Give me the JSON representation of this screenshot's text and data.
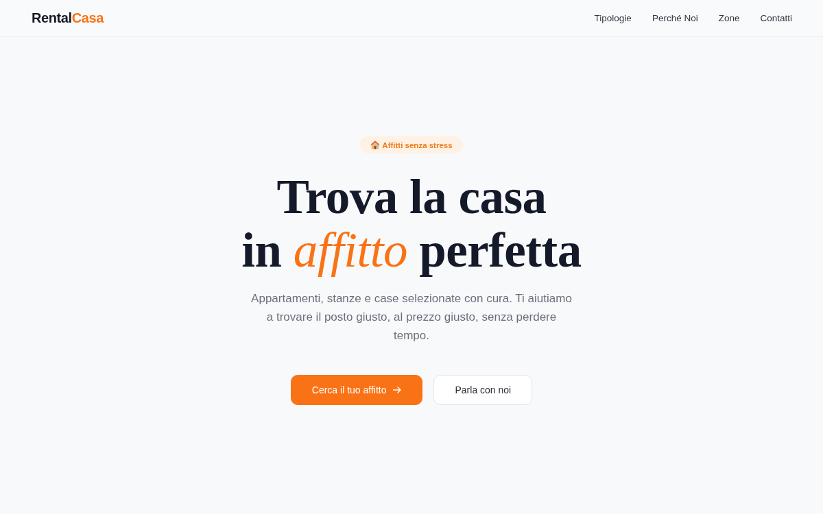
{
  "header": {
    "logo": {
      "text": "Rental",
      "accent": "Casa"
    },
    "nav": [
      "Tipologie",
      "Perché Noi",
      "Zone",
      "Contatti"
    ]
  },
  "hero": {
    "badge": "Affitti senza stress",
    "headline": [
      "Trova la casa",
      "in *affitto* perfetta"
    ],
    "subtitle": "Appartamenti, stanze e case selezionate con cura. Ti aiutiamo a trovare il posto giusto, al prezzo giusto, senza perdere tempo.",
    "buttons": [
      {
        "label": "Cerca il tuo affitto",
        "kind": "primary"
      },
      {
        "label": "Parla con noi",
        "kind": "secondary"
      }
    ]
  }
}
